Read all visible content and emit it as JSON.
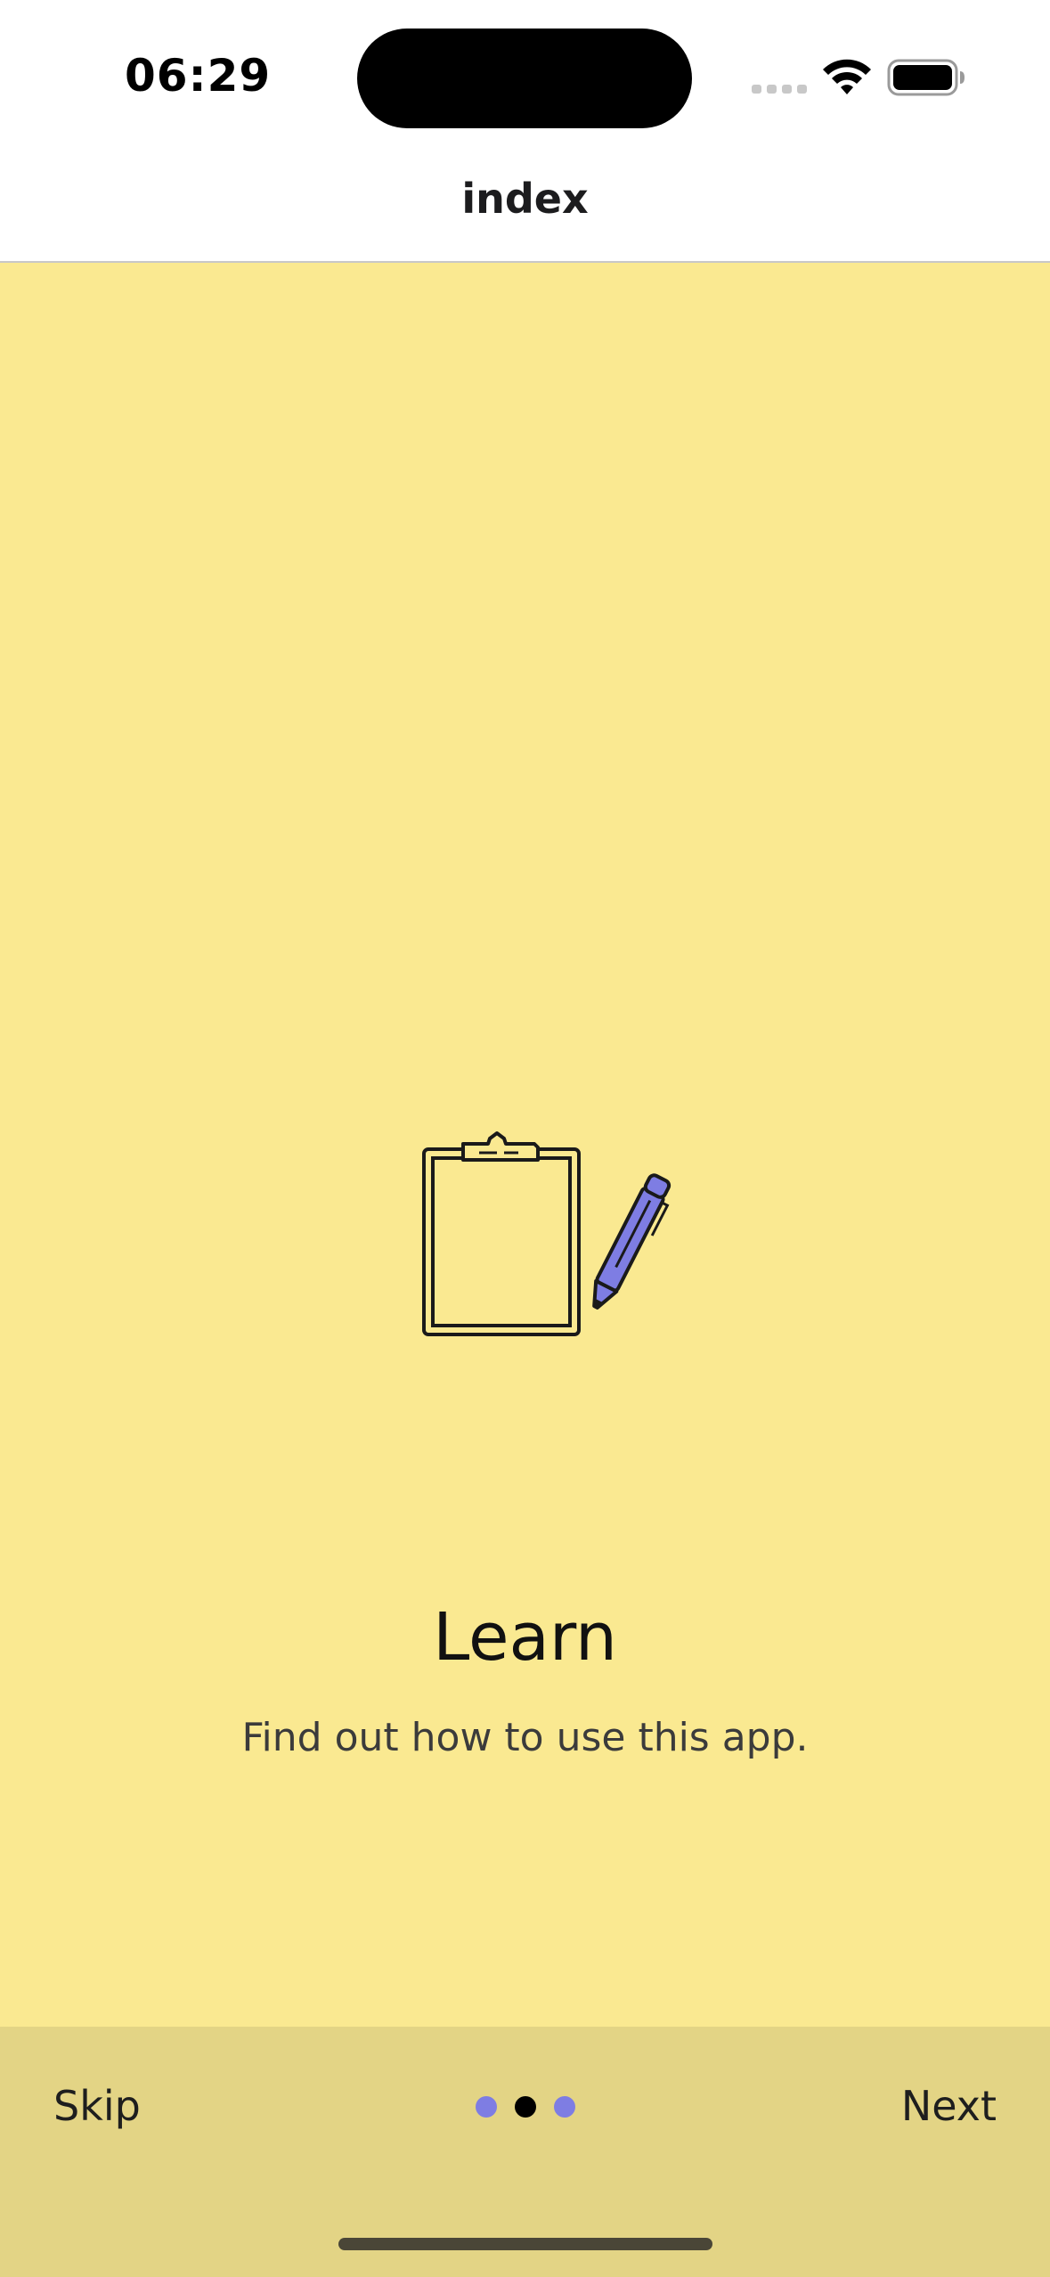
{
  "status_bar": {
    "time": "06:29",
    "icons": [
      "cellular-signal-icon",
      "wifi-icon",
      "battery-icon"
    ]
  },
  "header": {
    "title": "index"
  },
  "onboarding": {
    "illustration": "clipboard-pen-icon",
    "title": "Learn",
    "subtitle": "Find out how to use this app.",
    "background_color": "#fae991"
  },
  "pager": {
    "skip_label": "Skip",
    "next_label": "Next",
    "current_page": 2,
    "total_pages": 3,
    "bar_color": "#e3d485",
    "active_dot_color": "#000000",
    "inactive_dot_color": "#7e7de3"
  }
}
